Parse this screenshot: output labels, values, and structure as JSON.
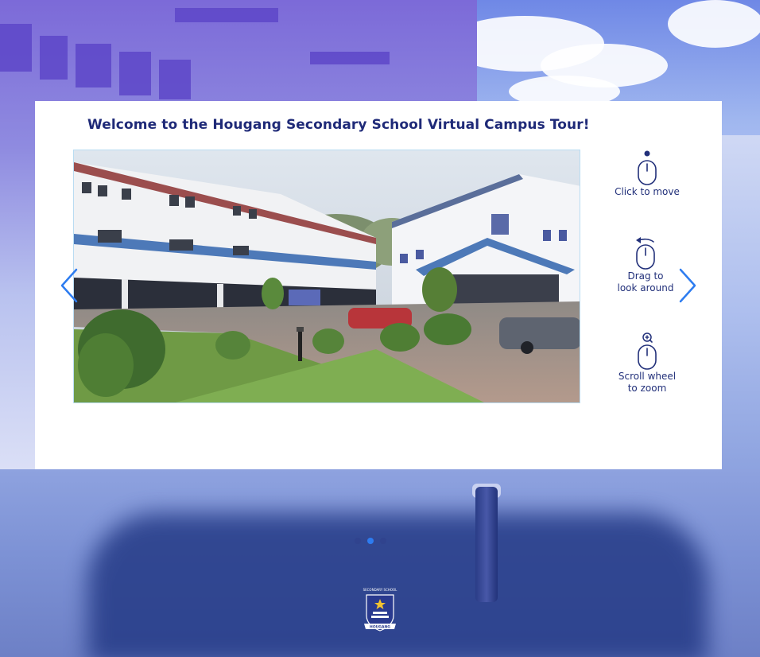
{
  "tour": {
    "title": "Welcome to the Hougang Secondary School Virtual Campus Tour!"
  },
  "instructions": [
    {
      "line1": "Click to move",
      "line2": "",
      "icon": "mouse-click-icon"
    },
    {
      "line1": "Drag to",
      "line2": "look around",
      "icon": "mouse-drag-icon"
    },
    {
      "line1": "Scroll wheel",
      "line2": "to zoom",
      "icon": "mouse-scroll-zoom-icon"
    }
  ],
  "carousel": {
    "slides": 3,
    "active_slide": 2,
    "prev_icon": "chevron-left-icon",
    "next_icon": "chevron-right-icon"
  },
  "logo": {
    "text_top": "SECONDARY SCHOOL",
    "text_bottom": "HOUGANG"
  },
  "colors": {
    "title": "#1f2a78",
    "accent": "#2d7cf0",
    "panel": "#ffffff"
  }
}
